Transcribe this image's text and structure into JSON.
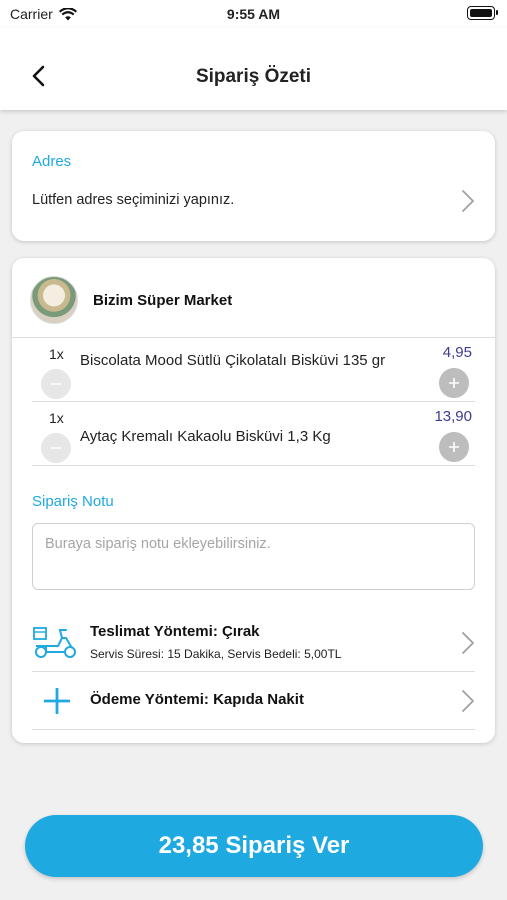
{
  "status_bar": {
    "carrier": "Carrier",
    "time": "9:55 AM"
  },
  "header": {
    "title": "Sipariş Özeti"
  },
  "address": {
    "title": "Adres",
    "prompt": "Lütfen adres seçiminizi yapınız."
  },
  "store": {
    "name": "Bizim Süper Market"
  },
  "items": [
    {
      "qty": "1x",
      "name": "Biscolata Mood Sütlü Çikolatalı Bisküvi 135 gr",
      "price": "4,95"
    },
    {
      "qty": "1x",
      "name": "Aytaç Kremalı Kakaolu Bisküvi 1,3 Kg",
      "price": "13,90"
    }
  ],
  "note": {
    "title": "Sipariş Notu",
    "placeholder": "Buraya sipariş notu ekleyebilirsiniz."
  },
  "delivery": {
    "title": "Teslimat Yöntemi: Çırak",
    "subtitle": "Servis Süresi: 15  Dakika, Servis Bedeli: 5,00TL"
  },
  "payment": {
    "title": "Ödeme Yöntemi: Kapıda Nakit"
  },
  "order_button": {
    "label": "23,85 Sipariş Ver"
  },
  "colors": {
    "accent": "#1fa9e1",
    "price": "#3b3b8f",
    "background": "#f0f0f0"
  }
}
